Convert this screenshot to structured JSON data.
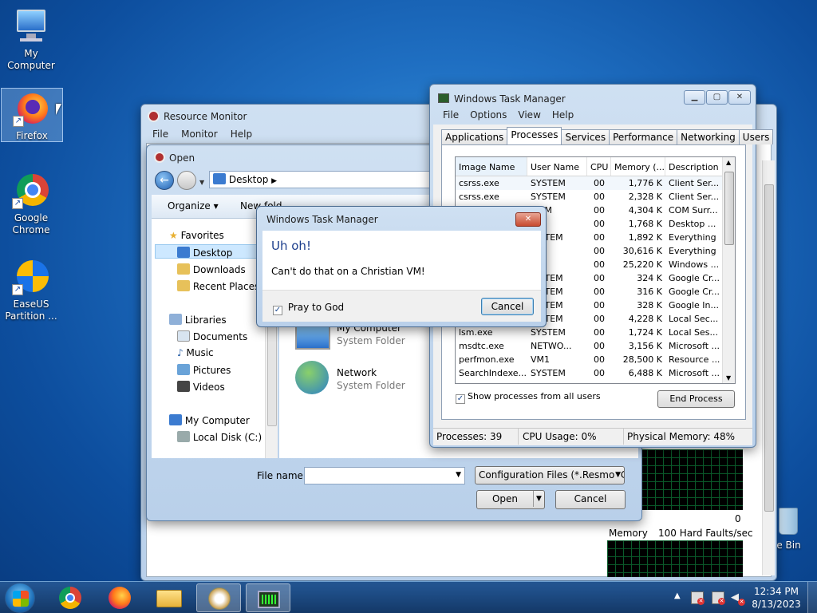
{
  "desktop": {
    "icons": [
      {
        "label": "My Computer"
      },
      {
        "label": "Firefox"
      },
      {
        "label": "Google Chrome"
      },
      {
        "label": "EaseUS Partition ..."
      },
      {
        "label": "le Bin"
      }
    ]
  },
  "resmon": {
    "title": "Resource Monitor",
    "menu": [
      "File",
      "Monitor",
      "Help"
    ],
    "memory_label": "Memory",
    "hard_faults": "100 Hard Faults/sec",
    "graph_zero": "0"
  },
  "open_dialog": {
    "title": "Open",
    "path": "Desktop",
    "organize": "Organize",
    "new_folder": "New fold",
    "nav": {
      "favorites": "Favorites",
      "desktop": "Desktop",
      "downloads": "Downloads",
      "recent": "Recent Places",
      "libraries": "Libraries",
      "documents": "Documents",
      "music": "Music",
      "pictures": "Pictures",
      "videos": "Videos",
      "mycomputer": "My Computer",
      "localdisk": "Local Disk (C:)"
    },
    "items": [
      {
        "name": "My Computer",
        "type": "System Folder"
      },
      {
        "name": "Network",
        "type": "System Folder"
      }
    ],
    "filename_label": "File name:",
    "filename_value": "",
    "filetype": "Configuration Files (*.ResmonC",
    "open_btn": "Open",
    "cancel_btn": "Cancel"
  },
  "taskmgr": {
    "title": "Windows Task Manager",
    "menu": [
      "File",
      "Options",
      "View",
      "Help"
    ],
    "tabs": [
      "Applications",
      "Processes",
      "Services",
      "Performance",
      "Networking",
      "Users"
    ],
    "columns": [
      "Image Name",
      "User Name",
      "CPU",
      "Memory (...",
      "Description"
    ],
    "rows": [
      [
        "csrss.exe",
        "SYSTEM",
        "00",
        "1,776 K",
        "Client Ser..."
      ],
      [
        "csrss.exe",
        "SYSTEM",
        "00",
        "2,328 K",
        "Client Ser..."
      ],
      [
        "",
        "...EM",
        "00",
        "4,304 K",
        "COM Surr..."
      ],
      [
        "",
        "",
        "00",
        "1,768 K",
        "Desktop ..."
      ],
      [
        "",
        "...STEM",
        "00",
        "1,892 K",
        "Everything"
      ],
      [
        "",
        "",
        "00",
        "30,616 K",
        "Everything"
      ],
      [
        "",
        "",
        "00",
        "25,220 K",
        "Windows ..."
      ],
      [
        "",
        "...STEM",
        "00",
        "324 K",
        "Google Cr..."
      ],
      [
        "",
        "...STEM",
        "00",
        "316 K",
        "Google Cr..."
      ],
      [
        "",
        "...STEM",
        "00",
        "328 K",
        "Google In..."
      ],
      [
        "",
        "...STEM",
        "00",
        "4,228 K",
        "Local Sec..."
      ],
      [
        "lsm.exe",
        "SYSTEM",
        "00",
        "1,724 K",
        "Local Ses..."
      ],
      [
        "msdtc.exe",
        "NETWO...",
        "00",
        "3,156 K",
        "Microsoft ..."
      ],
      [
        "perfmon.exe",
        "VM1",
        "00",
        "28,500 K",
        "Resource ..."
      ],
      [
        "SearchIndexe...",
        "SYSTEM",
        "00",
        "6,488 K",
        "Microsoft ..."
      ]
    ],
    "show_all": "Show processes from all users",
    "end_process": "End Process",
    "status": {
      "processes": "Processes: 39",
      "cpu": "CPU Usage: 0%",
      "memory": "Physical Memory: 48%"
    }
  },
  "error_dialog": {
    "title": "Windows Task Manager",
    "heading": "Uh oh!",
    "message": "Can't do that on a Christian VM!",
    "checkbox": "Pray to God",
    "cancel": "Cancel"
  },
  "taskbar": {
    "time": "12:34 PM",
    "date": "8/13/2023"
  }
}
